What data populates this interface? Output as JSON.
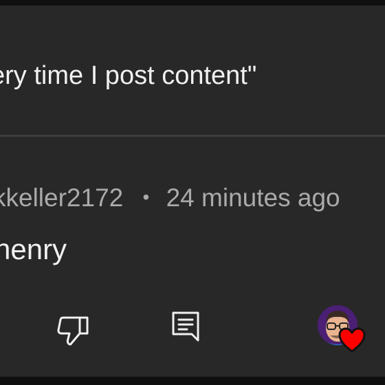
{
  "previous_comment": {
    "text": "ery time I post content\""
  },
  "comment": {
    "author": "kkeller2172",
    "separator": "•",
    "time": "24 minutes ago",
    "text": "henry"
  },
  "actions": {
    "dislike_icon": "thumbs-down-icon",
    "reply_icon": "reply-comment-icon",
    "creator_heart_icon": "creator-heart-icon"
  },
  "colors": {
    "background": "#282828",
    "text": "#f1f1f1",
    "secondary_text": "#aaaaaa",
    "heart": "#ff0000",
    "avatar_bg": "#4b1f74"
  }
}
